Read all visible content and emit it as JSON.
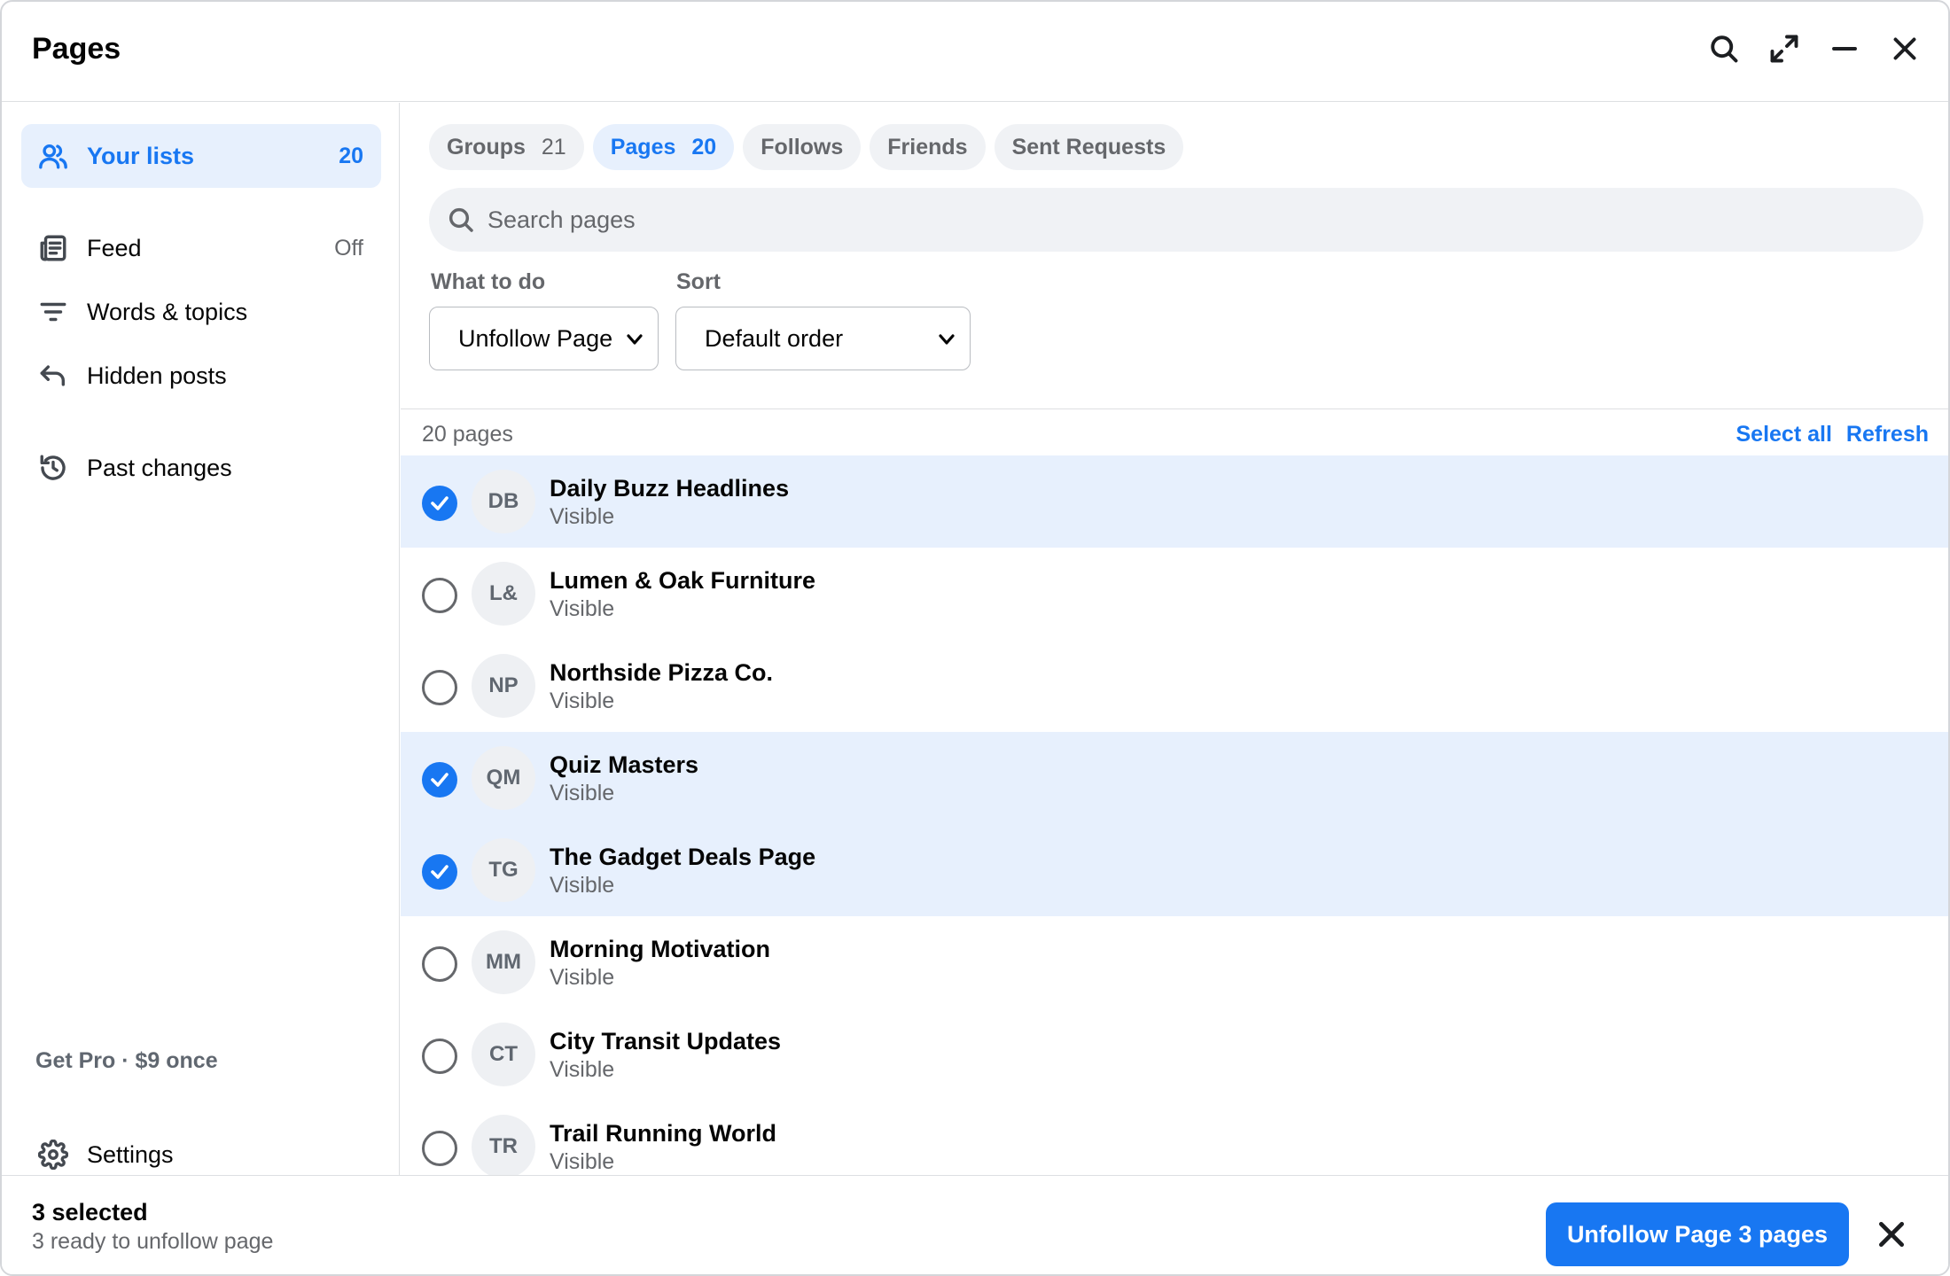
{
  "window": {
    "title": "Pages"
  },
  "header": {
    "icons": [
      "search-icon",
      "expand-icon",
      "minimize-icon",
      "close-icon"
    ]
  },
  "sidebar": {
    "items": [
      {
        "label": "Your lists",
        "count": "20",
        "icon": "people-icon",
        "active": true
      },
      {
        "label": "Feed",
        "count": "Off",
        "icon": "newspaper-icon"
      },
      {
        "label": "Words & topics",
        "count": "",
        "icon": "filter-lines-icon"
      },
      {
        "label": "Hidden posts",
        "count": "",
        "icon": "undo-arrow-icon"
      },
      {
        "label": "Past changes",
        "count": "",
        "icon": "history-icon"
      }
    ],
    "promo": "Get Pro · $9 once",
    "settings": {
      "label": "Settings",
      "icon": "gear-icon"
    }
  },
  "tabs": [
    {
      "label": "Groups",
      "count": "21"
    },
    {
      "label": "Pages",
      "count": "20",
      "active": true
    },
    {
      "label": "Follows",
      "count": ""
    },
    {
      "label": "Friends",
      "count": ""
    },
    {
      "label": "Sent Requests",
      "count": ""
    }
  ],
  "search": {
    "placeholder": "Search pages",
    "value": ""
  },
  "filters": {
    "action": {
      "label": "What to do",
      "value": "Unfollow Page"
    },
    "sort": {
      "label": "Sort",
      "value": "Default order"
    }
  },
  "list": {
    "count_text": "20 pages",
    "select_all": "Select all",
    "refresh": "Refresh",
    "rows": [
      {
        "initials": "DB",
        "name": "Daily Buzz Headlines",
        "status": "Visible",
        "selected": true
      },
      {
        "initials": "L&",
        "name": "Lumen & Oak Furniture",
        "status": "Visible",
        "selected": false
      },
      {
        "initials": "NP",
        "name": "Northside Pizza Co.",
        "status": "Visible",
        "selected": false
      },
      {
        "initials": "QM",
        "name": "Quiz Masters",
        "status": "Visible",
        "selected": true
      },
      {
        "initials": "TG",
        "name": "The Gadget Deals Page",
        "status": "Visible",
        "selected": true
      },
      {
        "initials": "MM",
        "name": "Morning Motivation",
        "status": "Visible",
        "selected": false
      },
      {
        "initials": "CT",
        "name": "City Transit Updates",
        "status": "Visible",
        "selected": false
      },
      {
        "initials": "TR",
        "name": "Trail Running World",
        "status": "Visible",
        "selected": false
      }
    ]
  },
  "footer": {
    "title": "3 selected",
    "subtitle": "3 ready to unfollow page",
    "action_button": "Unfollow Page 3 pages"
  },
  "colors": {
    "accent": "#1877f2",
    "selected_bg": "#e7f0fd",
    "muted_text": "#65676b"
  }
}
